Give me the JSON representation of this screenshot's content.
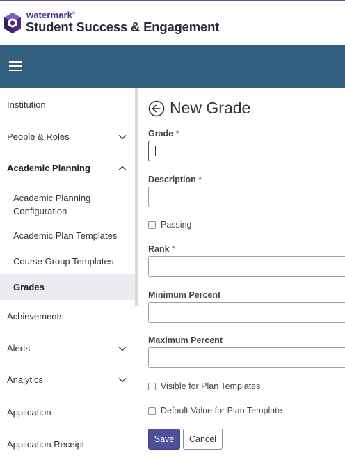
{
  "header": {
    "brand_small": "watermark",
    "brand_tm": "®",
    "brand_big": "Student Success & Engagement",
    "logo_icon": "watermark-hexagon-logo",
    "brand_color": "#4b2e83"
  },
  "navbar": {
    "menu_icon": "hamburger-menu-icon",
    "color": "#34607f"
  },
  "sidebar": {
    "items": [
      {
        "label": "Institution"
      },
      {
        "label": "People & Roles",
        "chevron": "down"
      },
      {
        "label": "Academic Planning",
        "chevron": "up",
        "expanded": true
      },
      {
        "label": "Academic Planning Configuration"
      },
      {
        "label": "Academic Plan Templates"
      },
      {
        "label": "Course Group Templates"
      },
      {
        "label": "Grades",
        "active": true
      },
      {
        "label": "Achievements"
      },
      {
        "label": "Alerts",
        "chevron": "down"
      },
      {
        "label": "Analytics",
        "chevron": "down"
      },
      {
        "label": "Application"
      },
      {
        "label": "Application Receipt"
      }
    ]
  },
  "main": {
    "title": "New Grade",
    "back_icon": "back-arrow-circle-icon",
    "fields": {
      "grade": {
        "label": "Grade",
        "required": "*",
        "value": ""
      },
      "description": {
        "label": "Description",
        "required": "*",
        "value": ""
      },
      "passing": {
        "label": "Passing",
        "checked": false
      },
      "rank": {
        "label": "Rank",
        "required": "*",
        "value": ""
      },
      "min_percent": {
        "label": "Minimum Percent",
        "value": ""
      },
      "max_percent": {
        "label": "Maximum Percent",
        "value": ""
      },
      "visible_templates": {
        "label": "Visible for Plan Templates",
        "checked": false
      },
      "default_template": {
        "label": "Default Value for Plan Template",
        "checked": false
      }
    },
    "buttons": {
      "save": "Save",
      "cancel": "Cancel"
    },
    "accent_color": "#4f4e98"
  }
}
